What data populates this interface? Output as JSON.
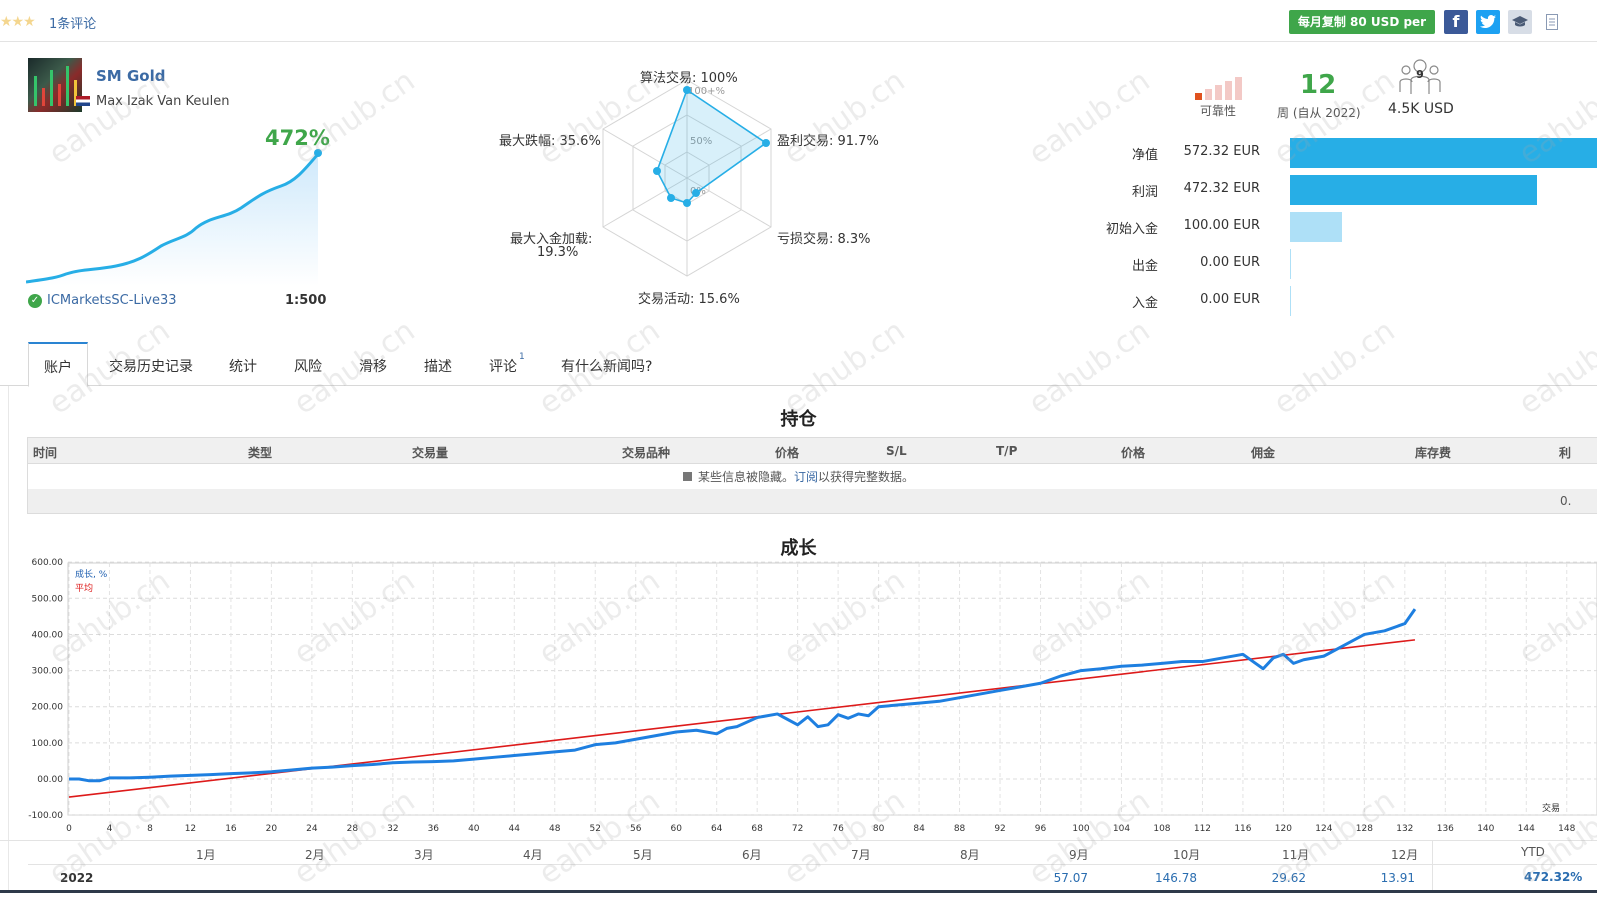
{
  "header": {
    "stars": "★★★",
    "reviews_link": "1条评论",
    "copy_button": "每月复制 80 USD per",
    "social": {
      "facebook": "f",
      "twitter": "t"
    }
  },
  "profile": {
    "signal_name": "SM Gold",
    "author": "Max Izak Van Keulen",
    "growth": "472%",
    "broker": "ICMarketsSC-Live33",
    "leverage": "1:500"
  },
  "radar": {
    "algo": "算法交易: 100%",
    "profit": "盈利交易: 91.7%",
    "loss": "亏损交易: 8.3%",
    "activity": "交易活动: 15.6%",
    "deposit_load_1": "最大入金加载:",
    "deposit_load_2": "19.3%",
    "drawdown": "最大跌幅: 35.6%",
    "ring_100": "100+%",
    "ring_50": "50%",
    "ring_0": "0%",
    "values": {
      "algo": 100,
      "profit": 91.7,
      "loss": 8.3,
      "activity": 15.6,
      "deposit_load": 19.3,
      "drawdown": 35.6
    }
  },
  "stats": {
    "reliability_label": "可靠性",
    "weeks": "12",
    "weeks_label": "周 (自从 2022)",
    "subscribers": "9",
    "subscriber_funds": "4.5K USD",
    "balance_rows": [
      {
        "label": "净值",
        "value": "572.32 EUR",
        "amount": 572.32
      },
      {
        "label": "利润",
        "value": "472.32 EUR",
        "amount": 472.32
      },
      {
        "label": "初始入金",
        "value": "100.00 EUR",
        "amount": 100.0
      },
      {
        "label": "出金",
        "value": "0.00 EUR",
        "amount": 0
      },
      {
        "label": "入金",
        "value": "0.00 EUR",
        "amount": 0
      }
    ]
  },
  "tabs": [
    "账户",
    "交易历史记录",
    "统计",
    "风险",
    "滑移",
    "描述",
    "评论",
    "有什么新闻吗?"
  ],
  "tab_badge": "1",
  "positions": {
    "title": "持仓",
    "columns": [
      "时间",
      "类型",
      "交易量",
      "交易品种",
      "价格",
      "S/L",
      "T/P",
      "价格",
      "佣金",
      "库存费",
      "利"
    ],
    "note_prefix": "某些信息被隐藏。",
    "note_link": "订阅",
    "note_suffix": "以获得完整数据。",
    "footer_value": "0."
  },
  "growth": {
    "title": "成长",
    "legend_growth": "成长, %",
    "legend_avg": "平均",
    "x_axis_label": "交易",
    "colors": {
      "growth": "#1e7fe0",
      "average": "#dd1a1a"
    },
    "months": [
      "1月",
      "2月",
      "3月",
      "4月",
      "5月",
      "6月",
      "7月",
      "8月",
      "9月",
      "10月",
      "11月",
      "12月"
    ],
    "year": "2022",
    "monthly": [
      {
        "month": "9月",
        "value": "57.07"
      },
      {
        "month": "10月",
        "value": "146.78"
      },
      {
        "month": "11月",
        "value": "29.62"
      },
      {
        "month": "12月",
        "value": "13.91"
      }
    ],
    "ytd_label": "YTD",
    "ytd_value": "472.32%"
  },
  "chart_data": {
    "type": "line",
    "title": "成长",
    "xlabel": "交易",
    "ylabel": "",
    "xlim": [
      0,
      148
    ],
    "ylim": [
      -100,
      600
    ],
    "x_ticks": [
      0,
      4,
      8,
      12,
      16,
      20,
      24,
      28,
      32,
      36,
      40,
      44,
      48,
      52,
      56,
      60,
      64,
      68,
      72,
      76,
      80,
      84,
      88,
      92,
      96,
      100,
      104,
      108,
      112,
      116,
      120,
      124,
      128,
      132,
      136,
      140,
      144,
      148
    ],
    "y_ticks": [
      "600.00",
      "500.00",
      "400.00",
      "300.00",
      "200.00",
      "100.00",
      "00.00",
      "-100.00"
    ],
    "y_tick_values": [
      600,
      500,
      400,
      300,
      200,
      100,
      0,
      -100
    ],
    "series": [
      {
        "name": "成长, %",
        "x": [
          0,
          1,
          2,
          3,
          4,
          6,
          8,
          10,
          12,
          14,
          16,
          18,
          20,
          22,
          24,
          26,
          28,
          30,
          32,
          34,
          36,
          38,
          40,
          42,
          44,
          46,
          48,
          50,
          52,
          54,
          56,
          58,
          60,
          62,
          64,
          65,
          66,
          68,
          70,
          71,
          72,
          73,
          74,
          75,
          76,
          77,
          78,
          79,
          80,
          82,
          84,
          86,
          88,
          90,
          92,
          94,
          96,
          98,
          100,
          102,
          104,
          106,
          108,
          110,
          112,
          114,
          116,
          117,
          118,
          119,
          120,
          121,
          122,
          124,
          126,
          128,
          130,
          132,
          133
        ],
        "y": [
          0,
          0,
          -5,
          -5,
          3,
          3,
          5,
          8,
          10,
          12,
          15,
          17,
          20,
          25,
          30,
          33,
          37,
          40,
          45,
          47,
          48,
          50,
          55,
          60,
          65,
          70,
          75,
          80,
          95,
          100,
          110,
          120,
          130,
          135,
          125,
          140,
          145,
          170,
          180,
          165,
          150,
          172,
          145,
          150,
          178,
          168,
          180,
          175,
          200,
          205,
          210,
          215,
          225,
          235,
          245,
          255,
          265,
          285,
          300,
          305,
          312,
          315,
          320,
          325,
          325,
          335,
          345,
          325,
          305,
          335,
          345,
          320,
          330,
          340,
          370,
          400,
          410,
          430,
          470
        ]
      },
      {
        "name": "平均",
        "x": [
          0,
          133
        ],
        "y": [
          -50,
          385
        ]
      }
    ]
  },
  "watermark": "eahub.cn"
}
